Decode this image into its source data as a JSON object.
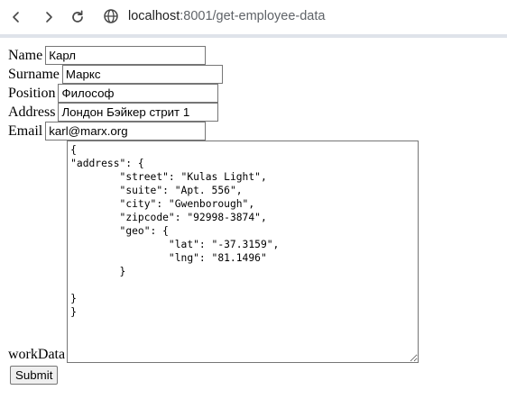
{
  "browser": {
    "url_host": "localhost",
    "url_path": ":8001/get-employee-data",
    "icons": {
      "back": "back-arrow-icon",
      "forward": "forward-arrow-icon",
      "reload": "reload-icon",
      "site_info": "site-info-icon"
    }
  },
  "form": {
    "name": {
      "label": "Name",
      "value": "Карл"
    },
    "surname": {
      "label": "Surname",
      "value": "Маркс"
    },
    "position": {
      "label": "Position",
      "value": "Философ"
    },
    "address": {
      "label": "Address",
      "value": "Лондон Бэйкер стрит 1"
    },
    "email": {
      "label": "Email",
      "value": "karl@marx.org"
    },
    "workData": {
      "label": "workData",
      "value": "{\n\"address\": {\n\t\"street\": \"Kulas Light\",\n\t\"suite\": \"Apt. 556\",\n\t\"city\": \"Gwenborough\",\n\t\"zipcode\": \"92998-3874\",\n\t\"geo\": {\n\t\t\"lat\": \"-37.3159\",\n\t\t\"lng\": \"81.1496\"\n\t}\n\n}\n}"
    },
    "submit_label": "Submit"
  }
}
